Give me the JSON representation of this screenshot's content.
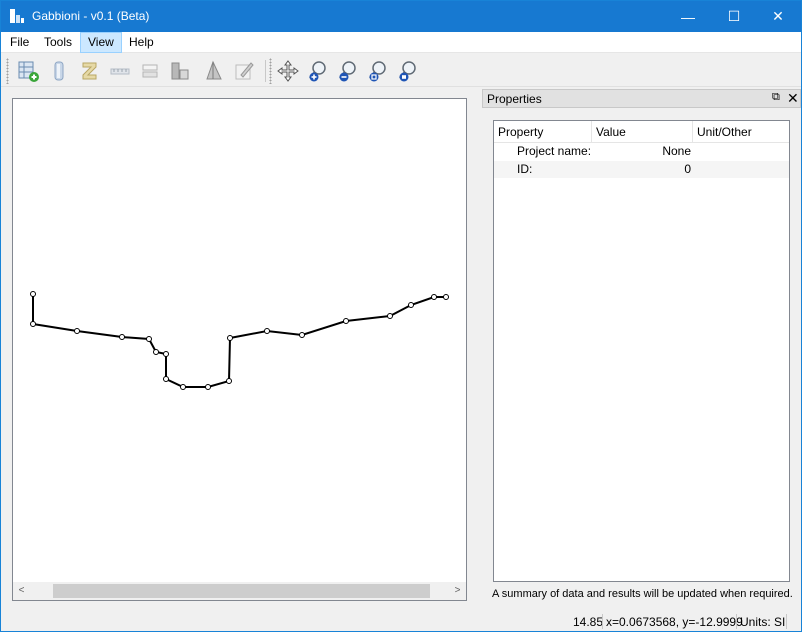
{
  "window": {
    "title": "Gabbioni - v0.1 (Beta)",
    "controls": {
      "minimize": "—",
      "maximize": "☐",
      "close": "✕"
    }
  },
  "menu": {
    "items": [
      "File",
      "Tools",
      "View",
      "Help"
    ],
    "active": "View"
  },
  "toolbar": {
    "buttons": [
      "add-section-icon",
      "layer-icon",
      "scale-icon",
      "dimension-icon",
      "bar-icon",
      "column-icon",
      "angle-icon",
      "draw-icon",
      "pan-icon",
      "zoom-in-icon",
      "zoom-out-icon",
      "zoom-fit-icon",
      "zoom-reset-icon"
    ]
  },
  "canvas": {
    "polyline_points_note": "profile section",
    "scroll_left": "<",
    "scroll_right": ">"
  },
  "properties": {
    "title": "Properties",
    "float_icon": "⧉",
    "close_icon": "✕",
    "columns": [
      "Property",
      "Value",
      "Unit/Other"
    ],
    "rows": [
      {
        "property": "Project name:",
        "value": "None",
        "unit": ""
      },
      {
        "property": "ID:",
        "value": "0",
        "unit": ""
      }
    ],
    "summary": "A summary of data and results will be updated when required."
  },
  "status": {
    "scale": "14.85",
    "coords": "x=0.0673568, y=-12.9999",
    "units": "Units: SI"
  },
  "colors": {
    "titlebar": "#1779d1",
    "menu_active": "#cce8ff"
  }
}
